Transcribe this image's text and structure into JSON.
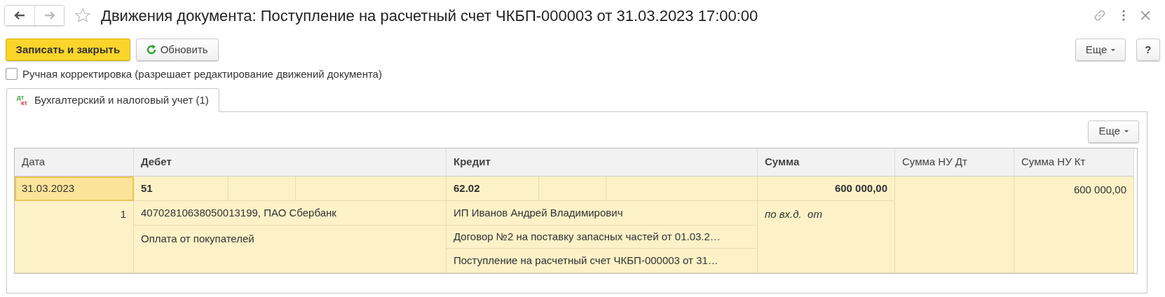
{
  "window": {
    "title": "Движения документа: Поступление на расчетный счет ЧКБП-000003 от 31.03.2023 17:00:00",
    "favorite": false,
    "back_enabled": true,
    "forward_enabled": false
  },
  "toolbar": {
    "buttons": [
      {
        "kind": "primary",
        "label": "Записать и закрыть"
      },
      {
        "kind": "refresh",
        "label": "Обновить"
      }
    ],
    "more_label": "Еще",
    "help_label": "?"
  },
  "manual_correction": {
    "label": "Ручная корректировка (разрешает редактирование движений документа)",
    "checked": false
  },
  "tabs": [
    {
      "icon_top": "дт",
      "icon_bottom": "кт",
      "label": "Бухгалтерский и налоговый учет (1)",
      "selected": true
    }
  ],
  "table_toolbar": {
    "more_label": "Еще"
  },
  "table": {
    "columns": [
      {
        "label": "Дата",
        "bold": false
      },
      {
        "label": "Дебет",
        "bold": true
      },
      {
        "label": "Кредит",
        "bold": true
      },
      {
        "label": "Сумма",
        "bold": true
      },
      {
        "label": "Сумма НУ Дт",
        "bold": false
      },
      {
        "label": "Сумма НУ Кт",
        "bold": false
      }
    ],
    "rows": [
      {
        "selected": true,
        "date": "31.03.2023",
        "line_number": "1",
        "debit": {
          "account": "51",
          "subconto": [
            "40702810638050013199, ПАО Сбербанк",
            "Оплата от покупателей"
          ]
        },
        "credit": {
          "account": "62.02",
          "subconto": [
            "ИП Иванов Андрей Владимирович",
            "Договор №2 на поставку запасных частей от 01.03.2…",
            "Поступление на расчетный счет ЧКБП-000003 от 31…"
          ]
        },
        "amount": "600 000,00",
        "amount_note": "по вх.д.  от",
        "amount_nu_kt": "600 000,00"
      }
    ]
  }
}
